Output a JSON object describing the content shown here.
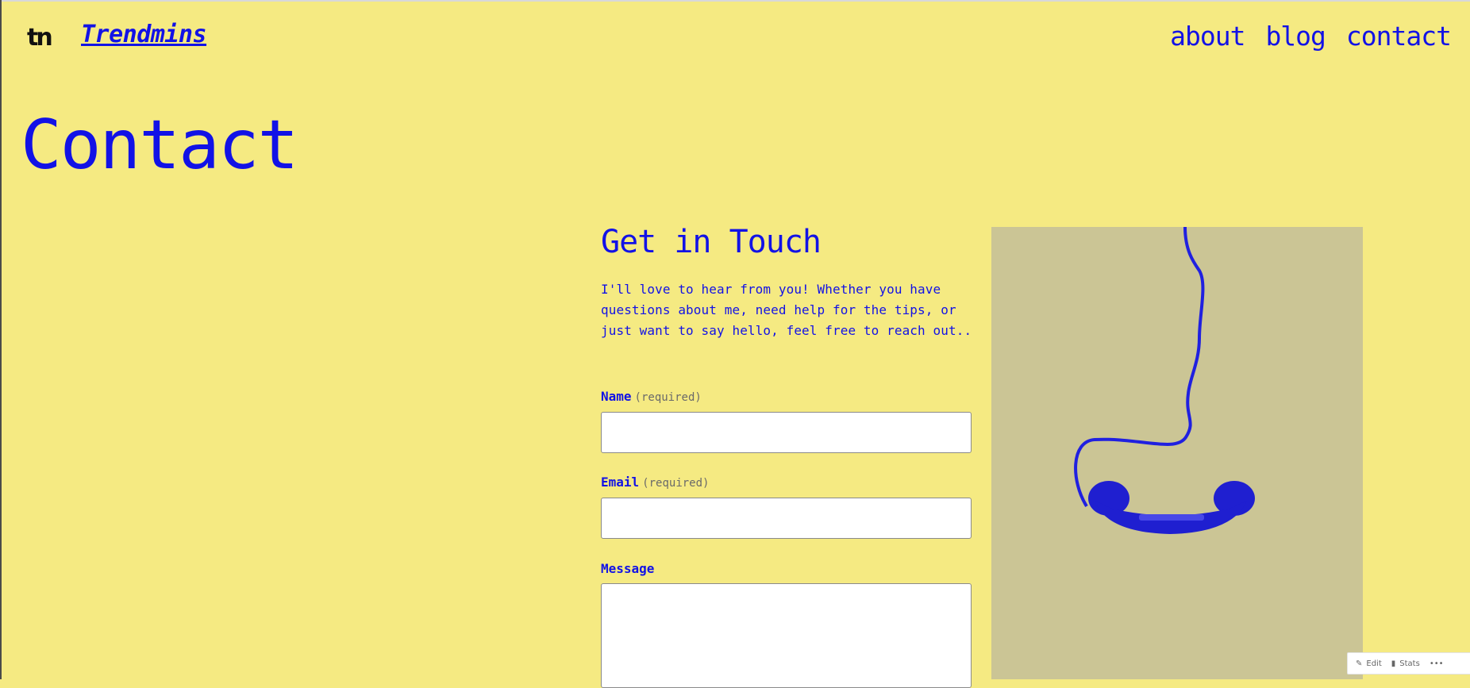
{
  "header": {
    "logo_text": "tn",
    "site_title": "Trendmins",
    "nav": [
      "about",
      "blog",
      "contact"
    ]
  },
  "page": {
    "title": "Contact"
  },
  "contact_section": {
    "heading": "Get in Touch",
    "intro": "I'll love to hear from you! Whether you have questions about me, need help for the tips, or just want to say hello, feel free to reach out..",
    "fields": [
      {
        "label": "Name",
        "required_text": "(required)"
      },
      {
        "label": "Email",
        "required_text": "(required)"
      },
      {
        "label": "Message",
        "required_text": ""
      }
    ]
  },
  "image": {
    "icon": "telephone-handset-icon"
  },
  "admin_bar": {
    "edit_label": "Edit",
    "stats_label": "Stats",
    "more_label": "•••"
  },
  "colors": {
    "background": "#f5ea82",
    "accent": "#1212e6",
    "image_bg": "#cbc595"
  }
}
